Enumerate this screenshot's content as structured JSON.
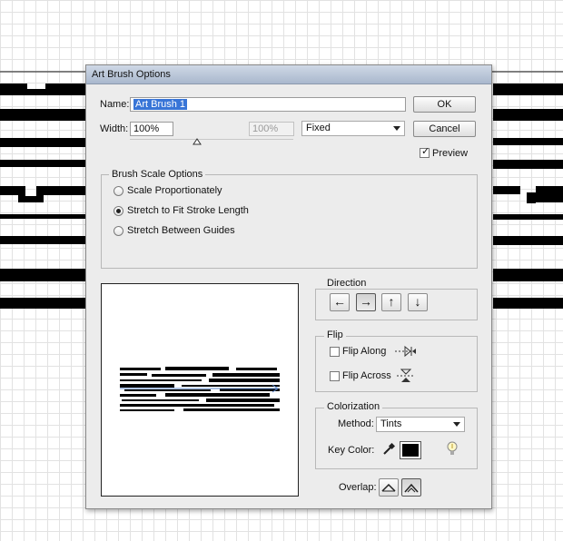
{
  "dialog": {
    "title": "Art Brush Options",
    "name_label": "Name:",
    "name_value": "Art Brush 1",
    "width_label": "Width:",
    "width_value": "100%",
    "width_max_value": "100%",
    "width_mode": "Fixed",
    "ok_label": "OK",
    "cancel_label": "Cancel",
    "preview_label": "Preview",
    "preview_checked": true
  },
  "scale": {
    "title": "Brush Scale Options",
    "options": [
      "Scale Proportionately",
      "Stretch to Fit Stroke Length",
      "Stretch Between Guides"
    ],
    "selected": "Stretch to Fit Stroke Length"
  },
  "direction": {
    "title": "Direction",
    "buttons": [
      {
        "icon": "arrow-left-icon",
        "glyph": "←",
        "active": false
      },
      {
        "icon": "arrow-right-icon",
        "glyph": "→",
        "active": true
      },
      {
        "icon": "arrow-up-icon",
        "glyph": "↑",
        "active": false
      },
      {
        "icon": "arrow-down-icon",
        "glyph": "↓",
        "active": false
      }
    ]
  },
  "flip": {
    "title": "Flip",
    "along_label": "Flip Along",
    "along_checked": false,
    "across_label": "Flip Across",
    "across_checked": false
  },
  "colorization": {
    "title": "Colorization",
    "method_label": "Method:",
    "method_value": "Tints",
    "key_color_label": "Key Color:",
    "key_color": "#000000"
  },
  "overlap": {
    "label": "Overlap:"
  },
  "colors": {
    "selection": "#3875d7",
    "dialog_bg": "#ececec"
  }
}
